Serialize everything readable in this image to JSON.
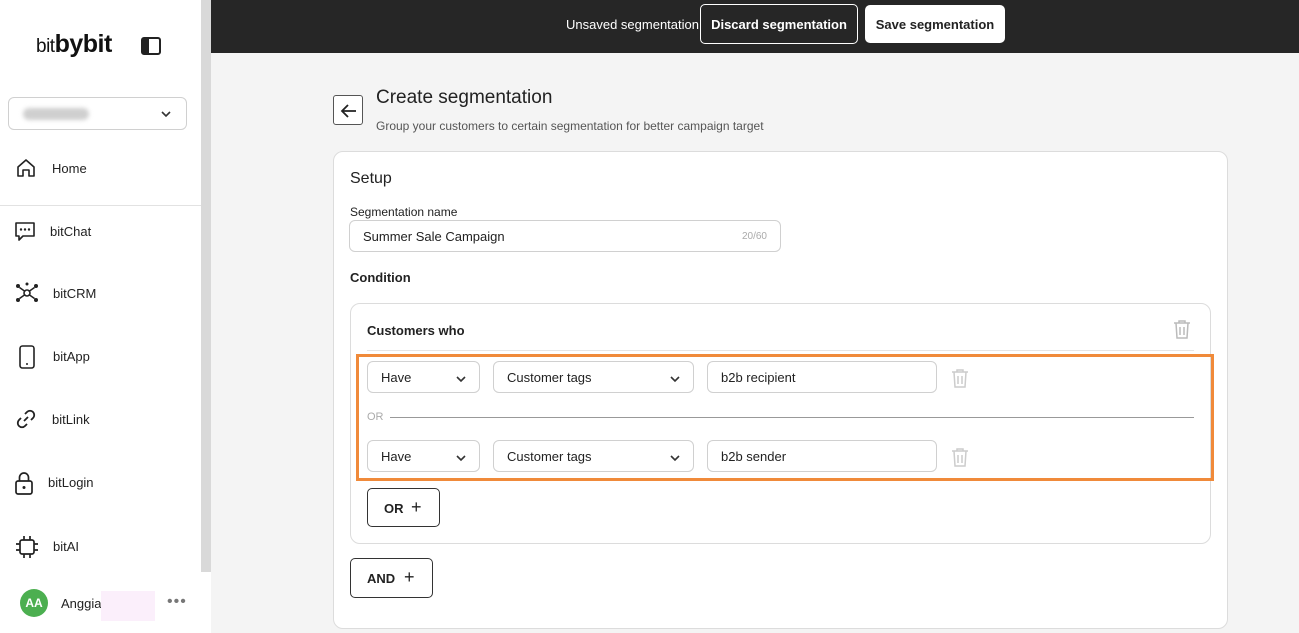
{
  "brand": {
    "logo_prefix": "bit",
    "logo_main": "bybit"
  },
  "sidebar": {
    "workspace_value": "",
    "items": [
      {
        "label": "Home",
        "icon": "home-icon"
      },
      {
        "label": "bitChat",
        "icon": "chat-icon"
      },
      {
        "label": "bitCRM",
        "icon": "network-icon"
      },
      {
        "label": "bitApp",
        "icon": "phone-icon"
      },
      {
        "label": "bitLink",
        "icon": "link-icon"
      },
      {
        "label": "bitLogin",
        "icon": "lock-icon"
      },
      {
        "label": "bitAI",
        "icon": "chip-icon"
      }
    ],
    "user": {
      "initials": "AA",
      "name": "Anggia",
      "more": "•••"
    }
  },
  "topbar": {
    "status_text": "Unsaved segmentation",
    "discard_label": "Discard segmentation",
    "save_label": "Save segmentation"
  },
  "header": {
    "title": "Create segmentation",
    "subtitle": "Group your customers to certain segmentation for better campaign target"
  },
  "setup": {
    "title": "Setup",
    "name_label": "Segmentation name",
    "name_value": "Summer Sale Campaign",
    "name_counter": "20/60",
    "condition_title": "Condition"
  },
  "condition_group": {
    "header": "Customers who",
    "rows": [
      {
        "operator": "Have",
        "field": "Customer tags",
        "value": "b2b recipient"
      },
      {
        "operator": "Have",
        "field": "Customer tags",
        "value": "b2b sender"
      }
    ],
    "separator": "OR",
    "or_button": "OR",
    "and_button": "AND"
  },
  "colors": {
    "topbar": "#262626",
    "highlight": "#f08a3a",
    "avatar": "#4caf50"
  }
}
